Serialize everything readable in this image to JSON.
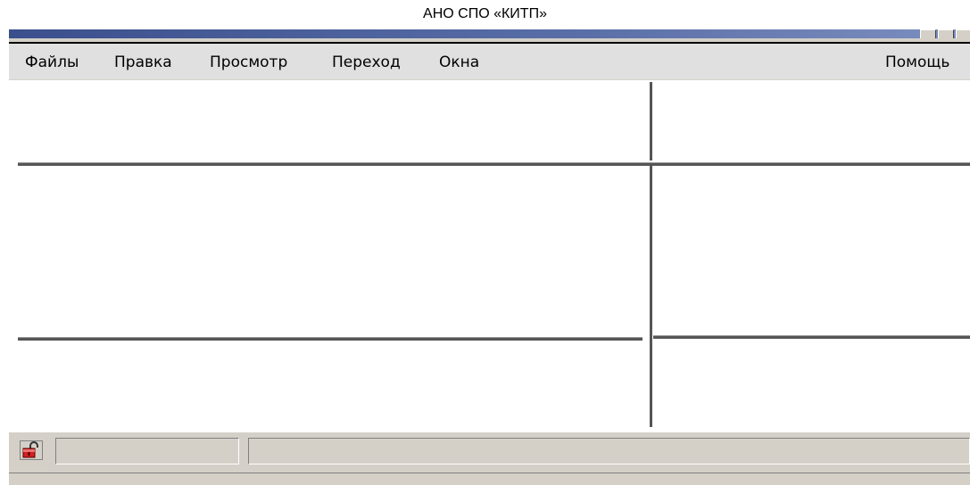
{
  "caption": "АНО СПО «КИТП»",
  "menu": {
    "files": "Файлы",
    "edit": "Правка",
    "view": "Просмотр",
    "go": "Переход",
    "windows": "Окна",
    "help": "Помощь"
  },
  "colors": {
    "window_bg": "#d4d0c8",
    "menubar_bg": "#e0e0e0",
    "separator": "#555555",
    "client_bg": "#ffffff"
  },
  "statusbar": {
    "lock_icon": "padlock-open-icon"
  }
}
